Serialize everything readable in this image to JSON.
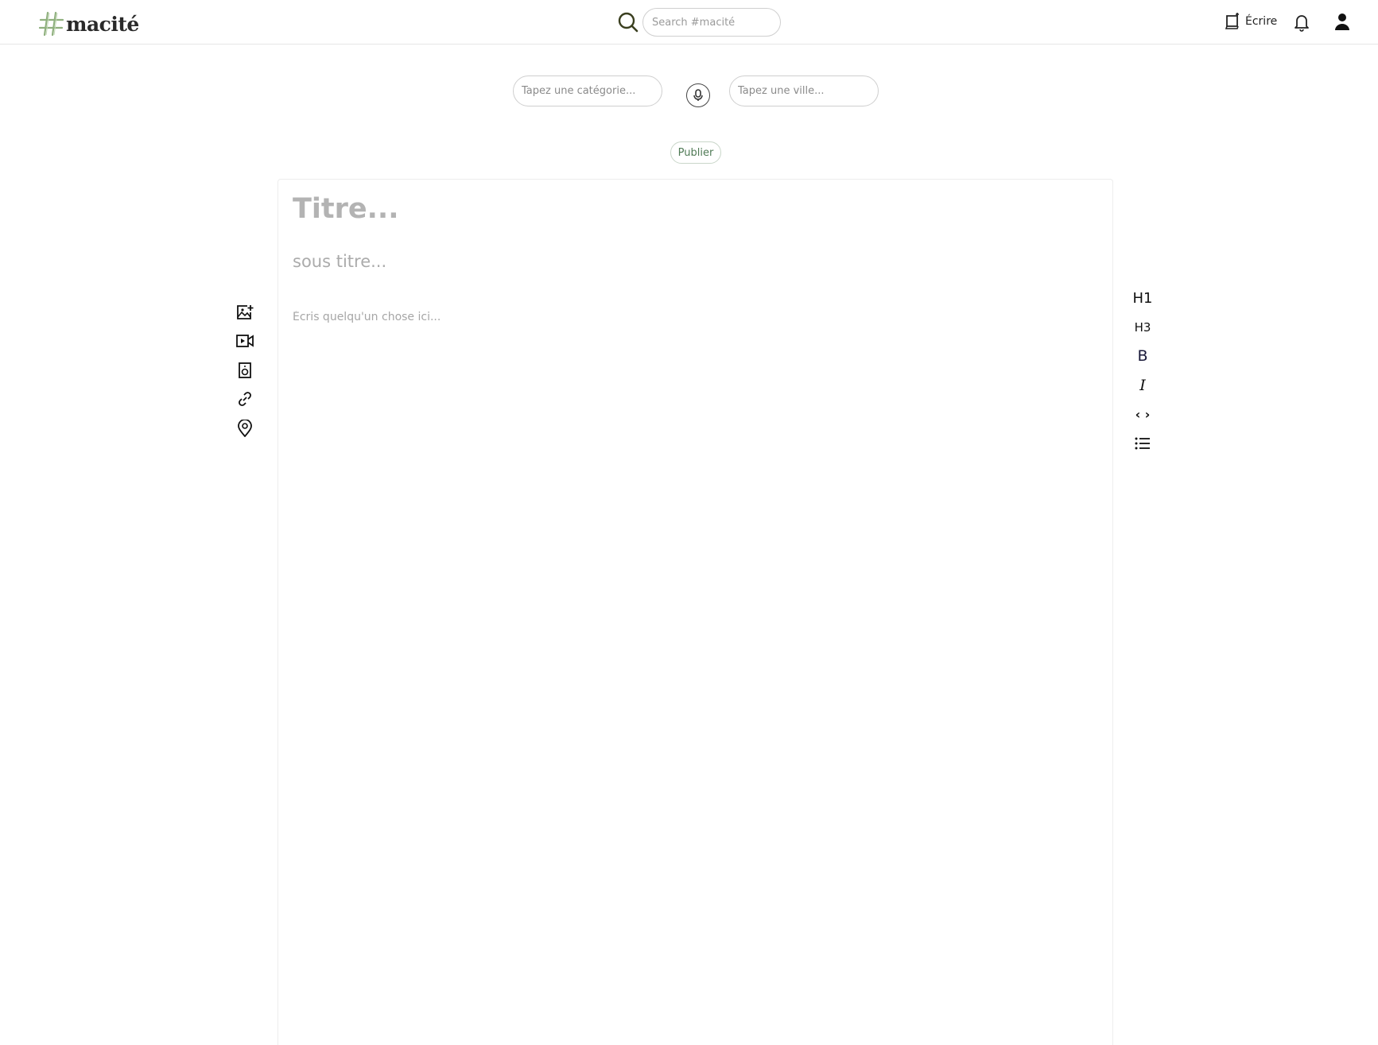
{
  "header": {
    "logo_text": "macité",
    "search_placeholder": "Search #macité",
    "write_label": "Écrire",
    "icons": [
      "search-icon",
      "compose-icon",
      "bell-icon",
      "user-icon"
    ]
  },
  "filters": {
    "category_placeholder": "Tapez une catégorie...",
    "city_placeholder": "Tapez une ville...",
    "mic_icon": "microphone-icon"
  },
  "publish_label": "Publier",
  "editor": {
    "title_placeholder": "Titre...",
    "subtitle_placeholder": "sous titre...",
    "body_placeholder": "Écris quelqu'un chose ici..."
  },
  "insert_tools": [
    "add-image-icon",
    "video-icon",
    "audio-icon",
    "link-icon",
    "location-icon"
  ],
  "format_tools": {
    "h1": "H1",
    "h3": "H3",
    "bold": "B",
    "italic": "I",
    "code": "‹ ›",
    "list_icon": "list-icon"
  },
  "colors": {
    "brand_green": "#6f9a5f",
    "publish_text": "#4f7a55",
    "placeholder_gray": "#b3b3b3"
  }
}
